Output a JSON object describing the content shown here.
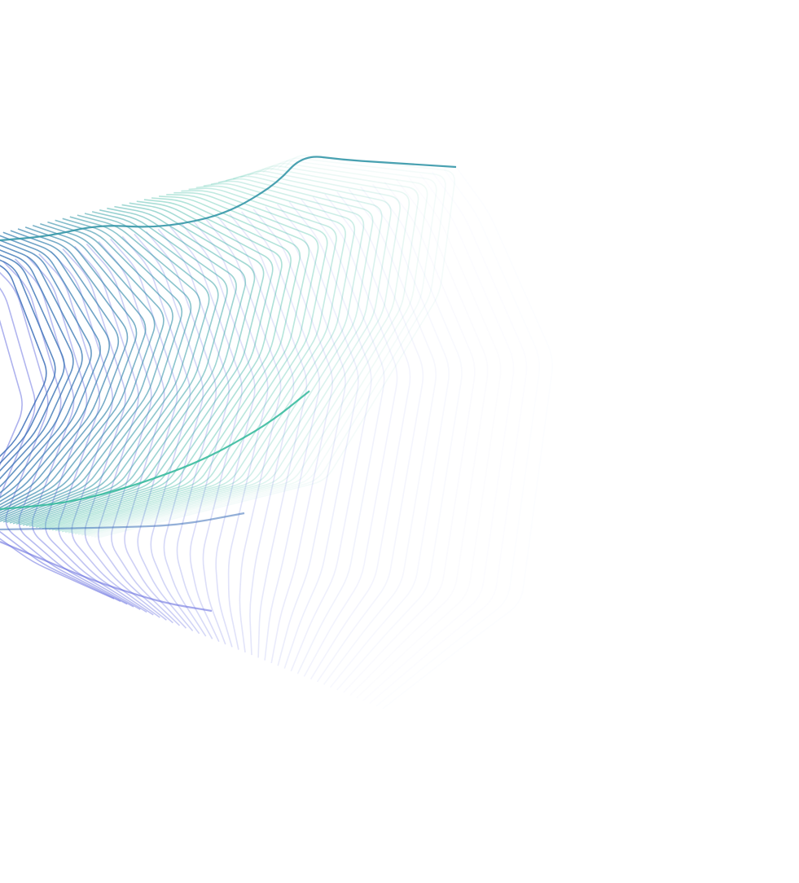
{
  "artwork": {
    "subject": "abstract-line-wave",
    "colors": {
      "teal": "#2fb89a",
      "blue": "#3d6fb8",
      "violet": "#6b72e0",
      "background": "#ffffff"
    }
  }
}
